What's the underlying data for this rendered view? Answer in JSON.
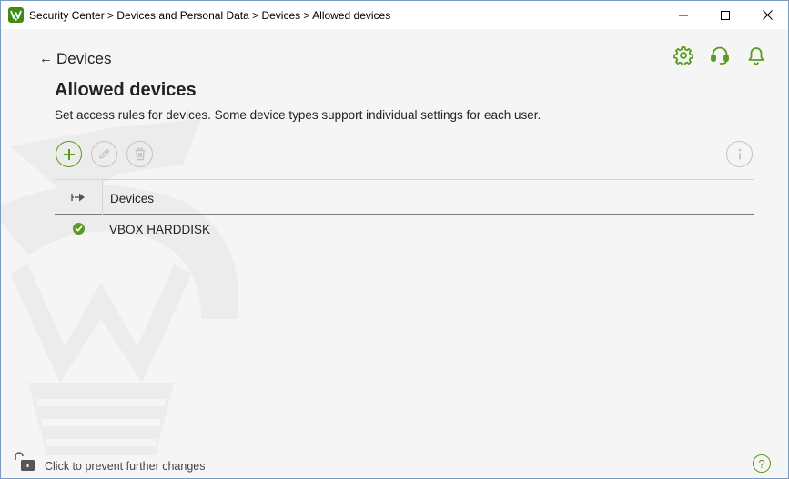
{
  "window": {
    "title": "Security Center > Devices and Personal Data > Devices > Allowed devices",
    "app_icon": "drweb-spider-icon",
    "controls": [
      "minimize-icon",
      "maximize-icon",
      "close-icon"
    ]
  },
  "header": {
    "back_label": "Devices",
    "back_arrow": "←",
    "icons": [
      "gear-icon",
      "headset-icon",
      "bell-icon"
    ]
  },
  "page": {
    "title": "Allowed devices",
    "description": "Set access rules for devices. Some device types support individual settings for each user."
  },
  "toolbar": {
    "buttons": [
      {
        "name": "add",
        "icon": "plus-icon",
        "enabled": true
      },
      {
        "name": "edit",
        "icon": "pencil-icon",
        "enabled": false
      },
      {
        "name": "delete",
        "icon": "trash-icon",
        "enabled": false
      },
      {
        "name": "info",
        "icon": "info-icon",
        "enabled": false
      }
    ]
  },
  "table": {
    "columns": [
      "Devices"
    ],
    "status_column_icon": "connection-icon",
    "rows": [
      {
        "status_icon": "check-icon",
        "status": "allowed",
        "device": "VBOX HARDDISK"
      }
    ]
  },
  "footer": {
    "lock_icon": "unlocked-padlock-icon",
    "text": "Click to prevent further changes",
    "help_icon": "help-icon",
    "help_glyph": "?"
  },
  "colors": {
    "accent": "#5a9a1e",
    "background": "#f5f5f5",
    "disabled": "#c4c4c4"
  }
}
